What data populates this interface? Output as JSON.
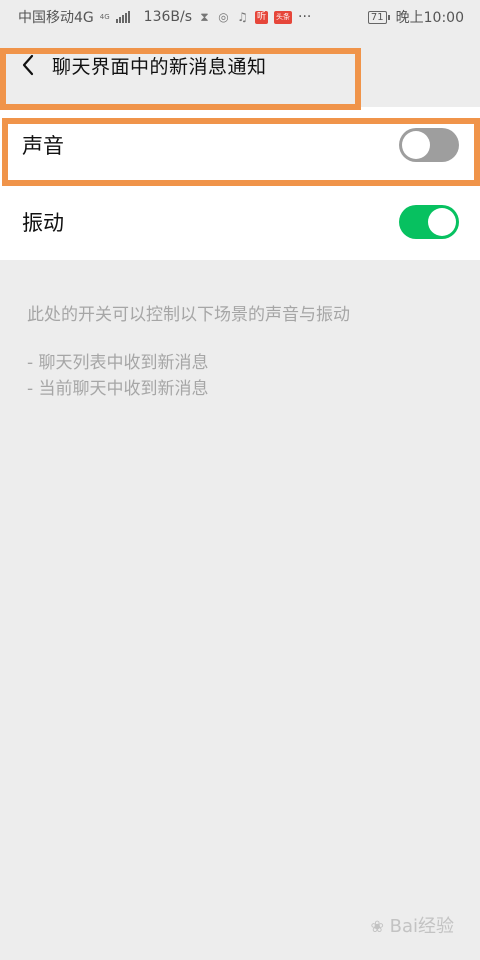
{
  "status_bar": {
    "carrier": "中国移动4G",
    "net_type_small": "4G",
    "speed": "136B/s",
    "battery": "71",
    "time": "晚上10:00",
    "app_badge_1": "听",
    "app_badge_2": "头条",
    "more": "···"
  },
  "header": {
    "title": "聊天界面中的新消息通知"
  },
  "settings": {
    "sound_label": "声音",
    "sound_on": false,
    "vibrate_label": "振动",
    "vibrate_on": true
  },
  "description": {
    "line1": "此处的开关可以控制以下场景的声音与振动",
    "line2": "- 聊天列表中收到新消息",
    "line3": "- 当前聊天中收到新消息"
  },
  "watermark": {
    "text": "Bai经验"
  },
  "colors": {
    "toggle_on": "#07c160",
    "toggle_off": "#9e9e9e",
    "highlight": "#f0944a"
  }
}
